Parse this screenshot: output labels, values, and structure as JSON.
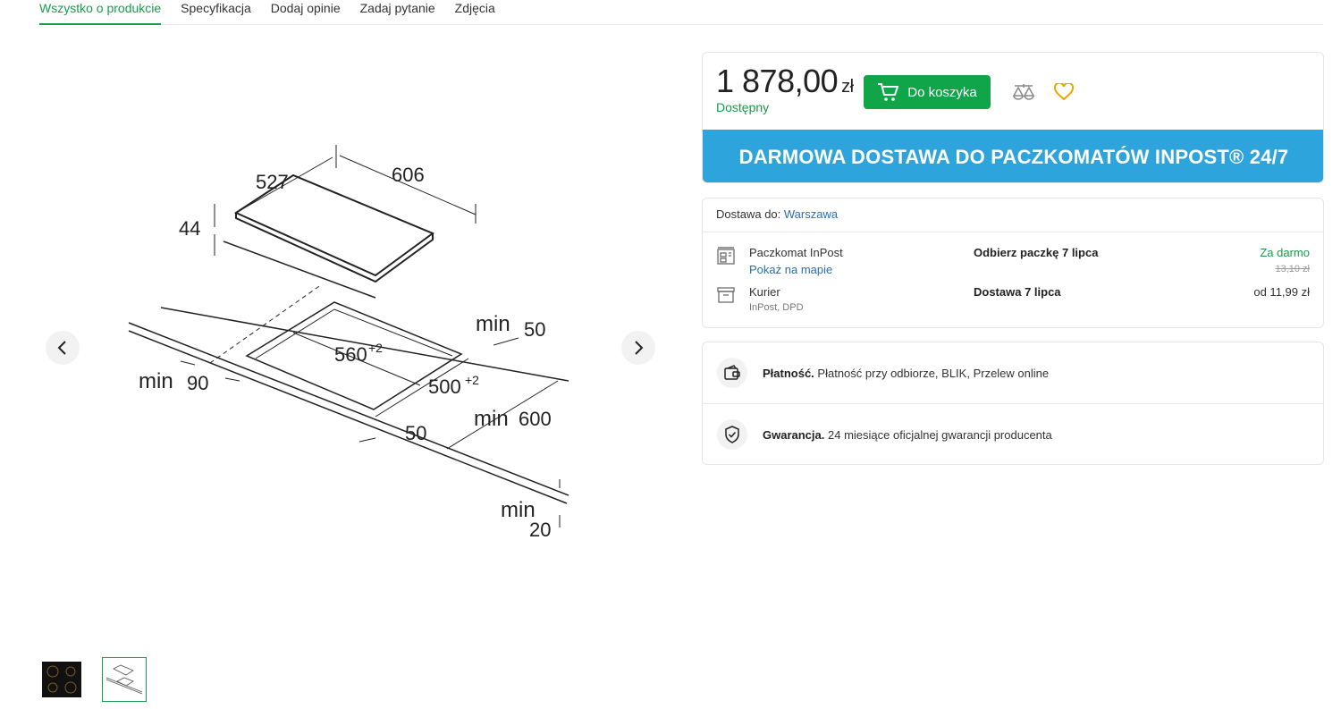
{
  "tabs": [
    {
      "label": "Wszystko o produkcie",
      "active": true
    },
    {
      "label": "Specyfikacja"
    },
    {
      "label": "Dodaj opinie"
    },
    {
      "label": "Zadaj pytanie"
    },
    {
      "label": "Zdjęcia"
    }
  ],
  "gallery": {
    "drawing_labels": {
      "d527": "527",
      "d606": "606",
      "d44": "44",
      "min50_a": "min",
      "min50_b": "50",
      "min90_a": "min",
      "min90_b": "90",
      "d560": "560",
      "d560_sup": "+2",
      "d500": "500",
      "d500_sup": "+2",
      "min600_a": "min",
      "min600_b": "600",
      "d50": "50",
      "min20_a": "min",
      "min20_b": "20"
    },
    "prev_icon": "chevron-left-icon",
    "next_icon": "chevron-right-icon",
    "thumbnails": [
      {
        "name": "hob-photo-thumbnail",
        "selected": false
      },
      {
        "name": "hob-drawing-thumbnail",
        "selected": true
      }
    ]
  },
  "buybox": {
    "price": "1 878,00",
    "currency": "zł",
    "availability": "Dostępny",
    "cart_button": "Do koszyka",
    "compare_icon": "compare-scale-icon",
    "favorite_icon": "heart-icon",
    "banner": "DARMOWA DOSTAWA DO PACZKOMATÓW INPOST® 24/7"
  },
  "delivery": {
    "dest_label": "Dostawa do:",
    "dest_city": "Warszawa",
    "options": [
      {
        "icon": "parcel-locker-icon",
        "name": "Paczkomat InPost",
        "sub": "Pokaż na mapie",
        "date": "Odbierz paczkę 7 lipca",
        "price": "Za darmo",
        "old_price": "13,10 zł"
      },
      {
        "icon": "courier-box-icon",
        "name": "Kurier",
        "sub": "InPost, DPD",
        "date": "Dostawa 7 lipca",
        "price": "od 11,99 zł"
      }
    ]
  },
  "info": {
    "payment_label": "Płatność.",
    "payment_text": "Płatność przy odbiorze, BLIK, Przelew online",
    "warranty_label": "Gwarancja.",
    "warranty_text": "24 miesiące oficjalnej gwarancji producenta"
  },
  "colors": {
    "accent_green": "#11a54a",
    "banner_blue": "#2ea4dc",
    "link_blue": "#2a6fb0",
    "favorite_gold": "#f0a500"
  }
}
